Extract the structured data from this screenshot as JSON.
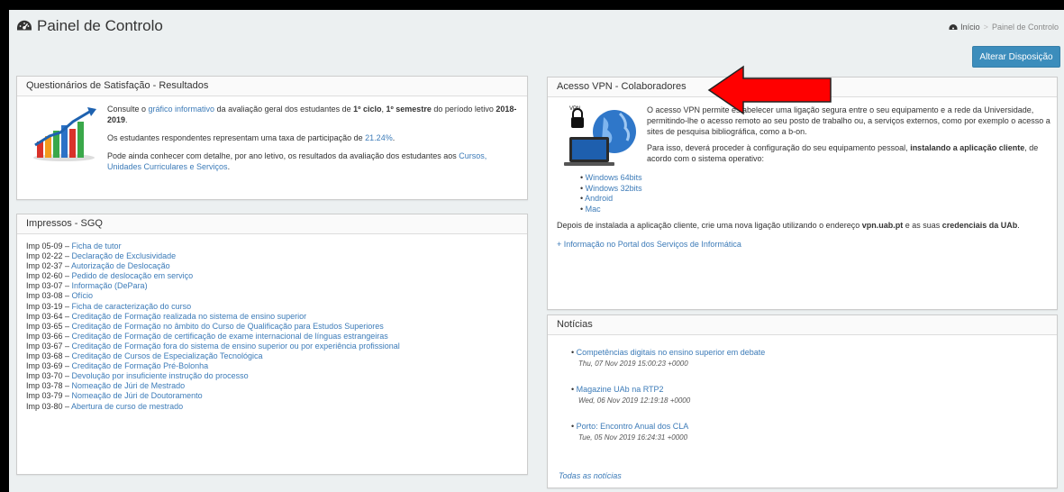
{
  "header": {
    "title": "Painel de Controlo",
    "breadcrumb_home": "Início",
    "breadcrumb_current": "Painel de Controlo",
    "layout_button": "Alterar Disposição"
  },
  "questionarios": {
    "heading": "Questionários de Satisfação - Resultados",
    "p1_a": "Consulte o ",
    "p1_link": "gráfico informativo",
    "p1_b": " da avaliação geral dos estudantes de ",
    "p1_bold1": "1º ciclo",
    "p1_c": ", ",
    "p1_bold2": "1º semestre",
    "p1_d": " do período letivo ",
    "p1_bold3": "2018-2019",
    "p1_e": ".",
    "p2_a": "Os estudantes respondentes representam uma taxa de participação de ",
    "p2_link": "21.24%",
    "p2_b": ".",
    "p3_a": "Pode ainda conhecer com detalhe, por ano letivo, os resultados da avaliação dos estudantes aos ",
    "p3_link": "Cursos, Unidades Curriculares e Serviços",
    "p3_b": "."
  },
  "impressos": {
    "heading": "Impressos - SGQ",
    "items": [
      {
        "code": "Imp 05-09 – ",
        "label": "Ficha de tutor"
      },
      {
        "code": "Imp 02-22 – ",
        "label": "Declaração de Exclusividade"
      },
      {
        "code": "Imp 02-37 – ",
        "label": "Autorização de Deslocação"
      },
      {
        "code": "Imp 02-60 – ",
        "label": "Pedido de deslocação em serviço"
      },
      {
        "code": "Imp 03-07 – ",
        "label": "Informação (DePara)"
      },
      {
        "code": "Imp 03-08 – ",
        "label": "Ofício"
      },
      {
        "code": "Imp 03-19 – ",
        "label": "Ficha de caracterização do curso"
      },
      {
        "code": "Imp 03-64 – ",
        "label": "Creditação de Formação realizada no sistema de ensino superior"
      },
      {
        "code": "Imp 03-65 – ",
        "label": "Creditação de Formação no âmbito do Curso de Qualificação para Estudos Superiores"
      },
      {
        "code": "Imp 03-66 – ",
        "label": "Creditação de Formação de certificação de exame internacional de línguas estrangeiras"
      },
      {
        "code": "Imp 03-67 – ",
        "label": "Creditação de Formação fora do sistema de ensino superior ou por experiência profissional"
      },
      {
        "code": "Imp 03-68 – ",
        "label": "Creditação de Cursos de Especialização Tecnológica"
      },
      {
        "code": "Imp 03-69 – ",
        "label": "Creditação de Formação Pré-Bolonha"
      },
      {
        "code": "Imp 03-70 – ",
        "label": "Devolução por insuficiente instrução do processo"
      },
      {
        "code": "Imp 03-78 – ",
        "label": "Nomeação de Júri de Mestrado"
      },
      {
        "code": "Imp 03-79 – ",
        "label": "Nomeação de Júri de Doutoramento"
      },
      {
        "code": "Imp 03-80 – ",
        "label": "Abertura de curso de mestrado"
      }
    ]
  },
  "vpn": {
    "heading": "Acesso VPN - Colaboradores",
    "icon_label": "VPN",
    "p1": "O acesso VPN permite estabelecer uma ligação segura entre o seu equipamento e a rede da Universidade, permitindo-lhe o acesso remoto ao seu posto de trabalho ou, a serviços externos, como por exemplo o acesso a sites de pesquisa bibliográfica, como a b-on.",
    "p2_a": "Para isso, deverá proceder à configuração do seu equipamento pessoal, ",
    "p2_bold": "instalando a aplicação cliente",
    "p2_b": ", de acordo com o sistema operativo:",
    "downloads": [
      "Windows 64bits",
      "Windows 32bits",
      "Android",
      "Mac"
    ],
    "after_a": "Depois de instalada a aplicação cliente, crie uma nova ligação utilizando o endereço ",
    "after_bold1": "vpn.uab.pt",
    "after_b": " e as suas ",
    "after_bold2": "credenciais da UAb",
    "after_c": ".",
    "more_link": "+ Informação no Portal dos Serviços de Informática"
  },
  "noticias": {
    "heading": "Notícias",
    "items": [
      {
        "title": "Competências digitais no ensino superior em debate",
        "date": "Thu, 07 Nov 2019 15:00:23 +0000"
      },
      {
        "title": "Magazine UAb na RTP2",
        "date": "Wed, 06 Nov 2019 12:19:18 +0000"
      },
      {
        "title": "Porto: Encontro Anual dos CLA",
        "date": "Tue, 05 Nov 2019 16:24:31 +0000"
      }
    ],
    "all_link": "Todas as notícias"
  },
  "colors": {
    "link": "#3c7bb8",
    "button": "#3c8dbc",
    "arrow": "#ff0000",
    "background": "#ecf0f1"
  },
  "icons": [
    "dashboard-icon",
    "bar-chart-growth-icon",
    "vpn-laptop-globe-icon",
    "red-arrow-annotation"
  ]
}
